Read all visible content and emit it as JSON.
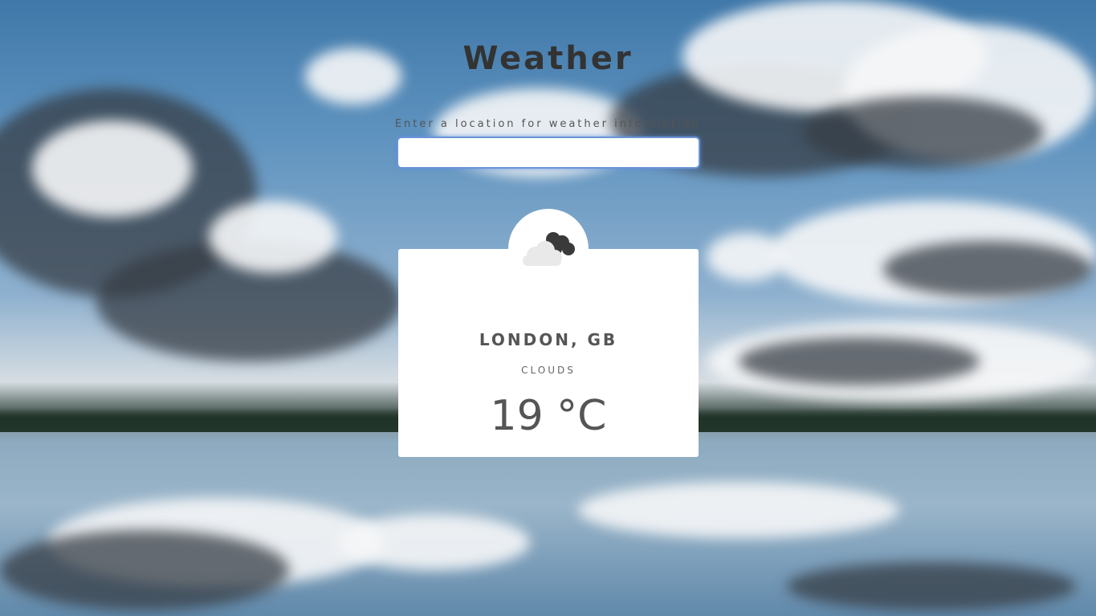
{
  "header": {
    "title": "Weather"
  },
  "search": {
    "label": "Enter a location for weather information",
    "value": "",
    "placeholder": ""
  },
  "weather": {
    "icon": "clouds-icon",
    "location": "LONDON, GB",
    "condition": "CLOUDS",
    "temperature": "19 °C"
  },
  "colors": {
    "title": "#333333",
    "card": "#ffffff",
    "input_border": "#6a95d6"
  }
}
